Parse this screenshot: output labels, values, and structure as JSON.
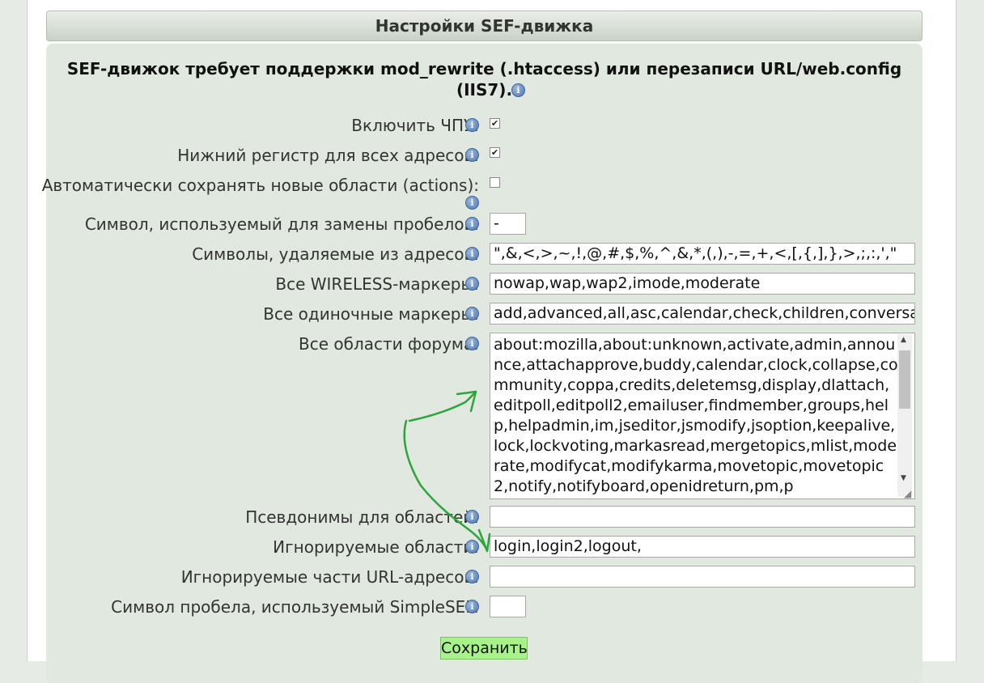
{
  "header": {
    "title": "Настройки SEF-движка"
  },
  "notice": {
    "text": "SEF-движок требует поддержки mod_rewrite (.htaccess) или перезаписи URL/web.config (IIS7)."
  },
  "info_icon_glyph": "i",
  "fields": {
    "enable_sef": {
      "label": "Включить ЧПУ:",
      "checked": true,
      "mark": "✔"
    },
    "lowercase": {
      "label": "Нижний регистр для всех адресов:",
      "checked": true,
      "mark": "✔"
    },
    "autosave_actions": {
      "label": "Автоматически сохранять новые области (actions):",
      "checked": false,
      "mark": ""
    },
    "space_char": {
      "label": "Символ, используемый для замены пробелов:",
      "value": "-"
    },
    "strip_chars": {
      "label": "Символы, удаляемые из адресов:",
      "value": "\",&,<,>,~,!,@,#,$,%,^,&,*,(,),-,=,+,<,[,{,],},>,;,:,',\""
    },
    "wireless_markers": {
      "label": "Все WIRELESS-маркеры:",
      "value": "nowap,wap,wap2,imode,moderate"
    },
    "single_markers": {
      "label": "Все одиночные маркеры:",
      "value": "add,advanced,all,asc,calendar,check,children,conversat"
    },
    "forum_actions": {
      "label": "Все области форума:",
      "value": "about:mozilla,about:unknown,activate,admin,announce,attachapprove,buddy,calendar,clock,collapse,community,coppa,credits,deletemsg,display,dlattach,editpoll,editpoll2,emailuser,findmember,groups,help,helpadmin,im,jseditor,jsmodify,jsoption,keepalive,lock,lockvoting,markasread,mergetopics,mlist,moderate,modifycat,modifykarma,movetopic,movetopic2,notify,notifyboard,openidreturn,pm,p"
    },
    "action_aliases": {
      "label": "Псевдонимы для областей:",
      "value": ""
    },
    "ignored_actions": {
      "label": "Игнорируемые области:",
      "value": "login,login2,logout,"
    },
    "ignored_url_parts": {
      "label": "Игнорируемые части URL-адресов:",
      "value": ""
    },
    "simplesef_space": {
      "label": "Символ пробела, используемый SimpleSEF:",
      "value": ""
    }
  },
  "save_button": {
    "label": "Сохранить"
  },
  "colors": {
    "panel_bg": "#e1e8df",
    "save_bg": "#a8f28a",
    "annotation_arrow": "#2aa63a"
  }
}
